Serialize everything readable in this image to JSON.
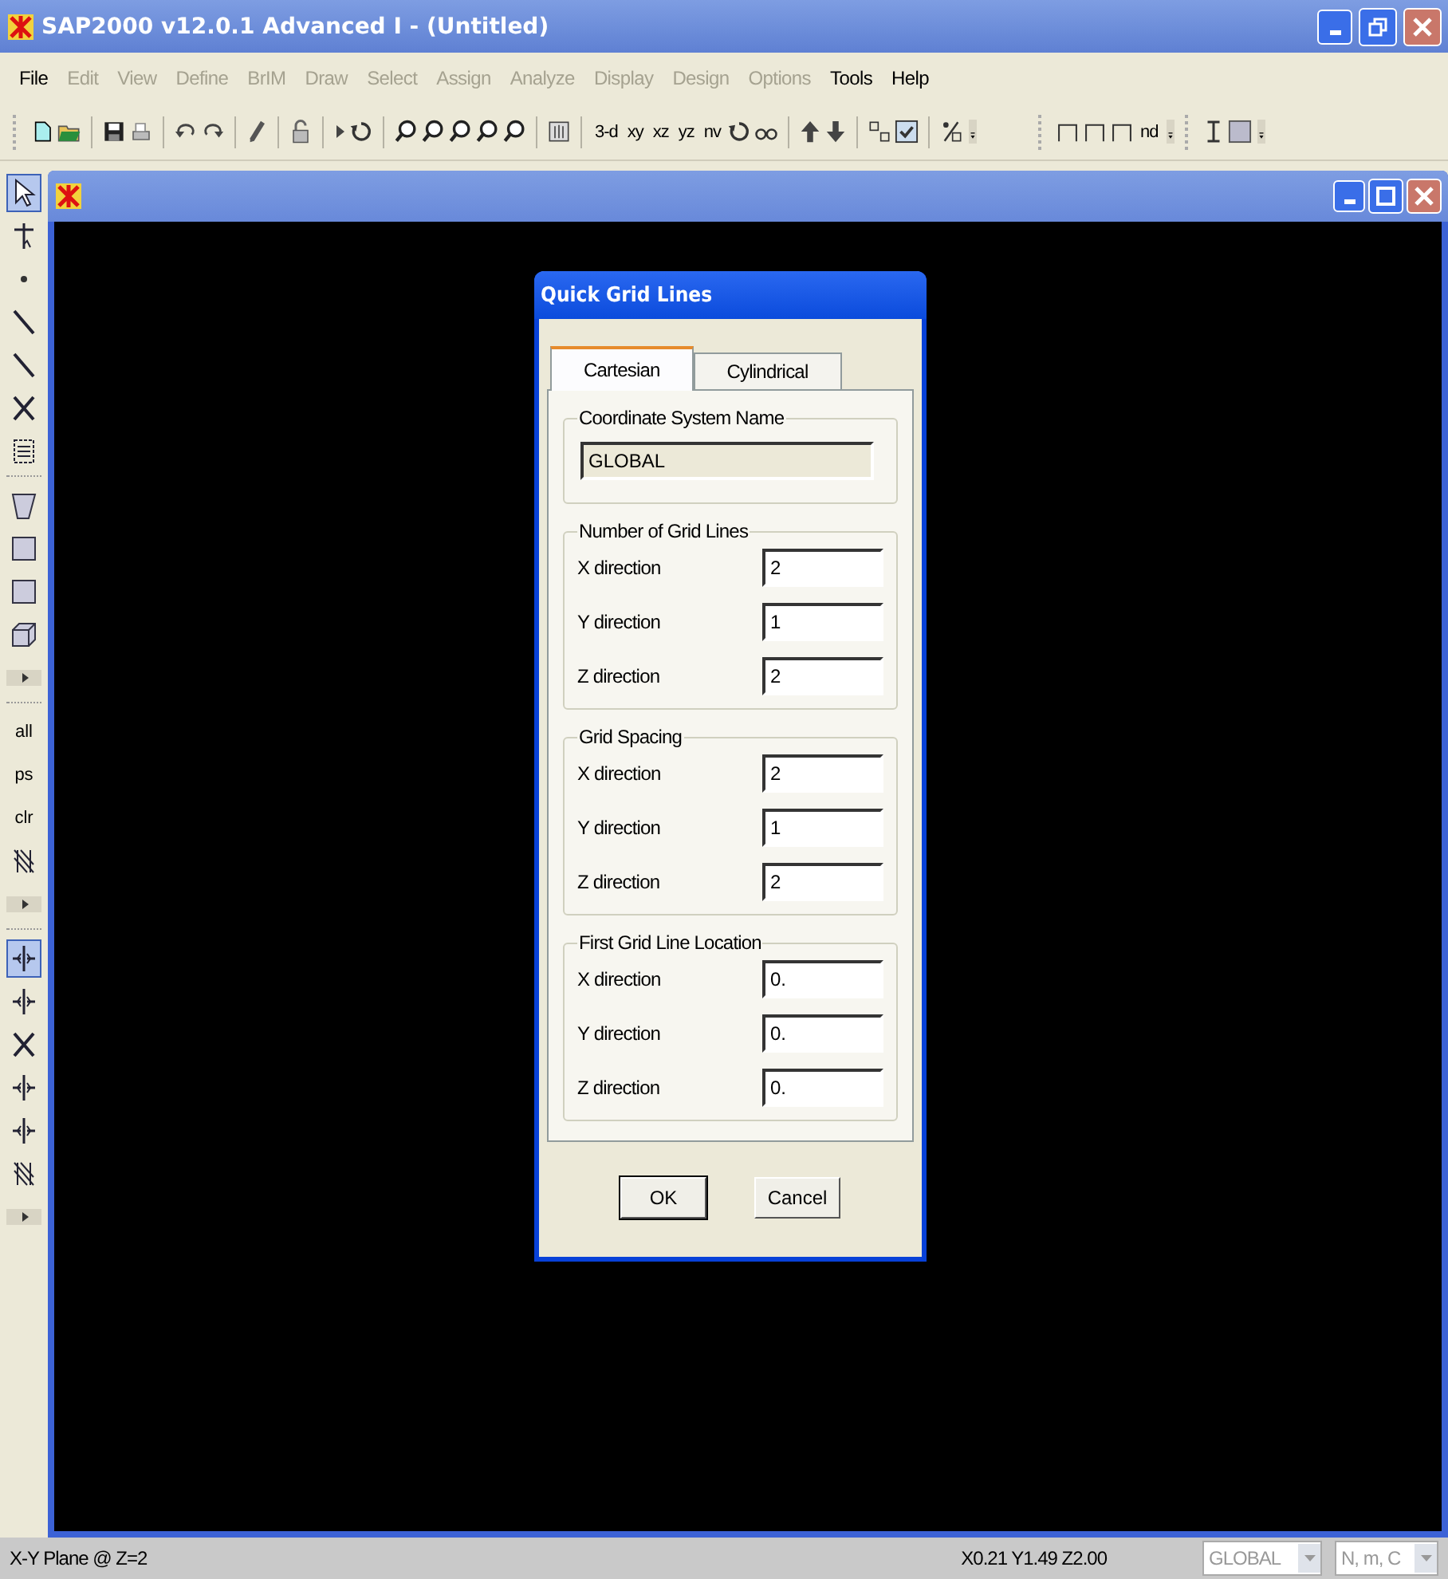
{
  "window": {
    "title": "SAP2000 v12.0.1 Advanced I  - (Untitled)"
  },
  "menu": [
    {
      "label": "File",
      "disabled": false
    },
    {
      "label": "Edit",
      "disabled": true
    },
    {
      "label": "View",
      "disabled": true
    },
    {
      "label": "Define",
      "disabled": true
    },
    {
      "label": "BrIM",
      "disabled": true
    },
    {
      "label": "Draw",
      "disabled": true
    },
    {
      "label": "Select",
      "disabled": true
    },
    {
      "label": "Assign",
      "disabled": true
    },
    {
      "label": "Analyze",
      "disabled": true
    },
    {
      "label": "Display",
      "disabled": true
    },
    {
      "label": "Design",
      "disabled": true
    },
    {
      "label": "Options",
      "disabled": true
    },
    {
      "label": "Tools",
      "disabled": false
    },
    {
      "label": "Help",
      "disabled": false
    }
  ],
  "toolbar": [
    {
      "kind": "grip"
    },
    {
      "kind": "new"
    },
    {
      "kind": "open"
    },
    {
      "kind": "sep"
    },
    {
      "kind": "save"
    },
    {
      "kind": "print"
    },
    {
      "kind": "sep"
    },
    {
      "kind": "undo"
    },
    {
      "kind": "redo"
    },
    {
      "kind": "sep"
    },
    {
      "kind": "pencil"
    },
    {
      "kind": "sep"
    },
    {
      "kind": "lock"
    },
    {
      "kind": "sep"
    },
    {
      "kind": "play"
    },
    {
      "kind": "rotate"
    },
    {
      "kind": "sep"
    },
    {
      "kind": "zoom"
    },
    {
      "kind": "zoom"
    },
    {
      "kind": "zoom"
    },
    {
      "kind": "zoom"
    },
    {
      "kind": "zoom"
    },
    {
      "kind": "sep"
    },
    {
      "kind": "pan"
    },
    {
      "kind": "sep"
    },
    {
      "kind": "text",
      "label": "3-d"
    },
    {
      "kind": "text",
      "label": "xy"
    },
    {
      "kind": "text",
      "label": "xz"
    },
    {
      "kind": "text",
      "label": "yz"
    },
    {
      "kind": "text",
      "label": "nv"
    },
    {
      "kind": "rotate"
    },
    {
      "kind": "glasses"
    },
    {
      "kind": "sep"
    },
    {
      "kind": "up"
    },
    {
      "kind": "down"
    },
    {
      "kind": "sep"
    },
    {
      "kind": "resize"
    },
    {
      "kind": "check"
    },
    {
      "kind": "sep"
    },
    {
      "kind": "percent"
    },
    {
      "kind": "end"
    },
    {
      "kind": "gap"
    },
    {
      "kind": "grip"
    },
    {
      "kind": "frame"
    },
    {
      "kind": "frame"
    },
    {
      "kind": "frame"
    },
    {
      "kind": "text",
      "label": "nd"
    },
    {
      "kind": "end"
    },
    {
      "kind": "grip"
    },
    {
      "kind": "ibeam"
    },
    {
      "kind": "square"
    },
    {
      "kind": "end"
    }
  ],
  "side_toolbar": [
    {
      "kind": "pointer",
      "selected": true
    },
    {
      "kind": "reshape",
      "selected": false
    },
    {
      "kind": "point",
      "selected": false
    },
    {
      "kind": "line",
      "selected": false
    },
    {
      "kind": "line",
      "selected": false
    },
    {
      "kind": "cross",
      "selected": false
    },
    {
      "kind": "list",
      "selected": false
    },
    {
      "kind": "sep"
    },
    {
      "kind": "poly",
      "selected": false
    },
    {
      "kind": "rect",
      "selected": false
    },
    {
      "kind": "rect",
      "selected": false
    },
    {
      "kind": "solid",
      "selected": false
    },
    {
      "kind": "more"
    },
    {
      "kind": "sep"
    },
    {
      "kind": "text",
      "label": "all",
      "selected": false
    },
    {
      "kind": "text",
      "label": "ps",
      "selected": false
    },
    {
      "kind": "text",
      "label": "clr",
      "selected": false
    },
    {
      "kind": "hatch",
      "selected": false
    },
    {
      "kind": "more"
    },
    {
      "kind": "sep"
    },
    {
      "kind": "snap",
      "selected": true
    },
    {
      "kind": "snap",
      "selected": false
    },
    {
      "kind": "cross",
      "selected": false
    },
    {
      "kind": "snap",
      "selected": false
    },
    {
      "kind": "snap",
      "selected": false
    },
    {
      "kind": "hatch",
      "selected": false
    },
    {
      "kind": "more"
    }
  ],
  "dialog": {
    "title": "Quick Grid Lines",
    "tabs": [
      {
        "label": "Cartesian",
        "selected": true
      },
      {
        "label": "Cylindrical",
        "selected": false
      }
    ],
    "coordinate_system": {
      "legend": "Coordinate System Name",
      "value": "GLOBAL"
    },
    "groups": [
      {
        "legend": "Number of Grid Lines",
        "fields": [
          {
            "label": "X direction",
            "value": "2"
          },
          {
            "label": "Y direction",
            "value": "1"
          },
          {
            "label": "Z direction",
            "value": "2"
          }
        ]
      },
      {
        "legend": "Grid Spacing",
        "fields": [
          {
            "label": "X direction",
            "value": "2"
          },
          {
            "label": "Y direction",
            "value": "1"
          },
          {
            "label": "Z direction",
            "value": "2"
          }
        ]
      },
      {
        "legend": "First Grid Line Location",
        "fields": [
          {
            "label": "X direction",
            "value": "0."
          },
          {
            "label": "Y direction",
            "value": "0."
          },
          {
            "label": "Z direction",
            "value": "0."
          }
        ]
      }
    ],
    "buttons": [
      {
        "label": "OK",
        "default": true
      },
      {
        "label": "Cancel",
        "default": false
      }
    ]
  },
  "status_bar": {
    "view": "X-Y Plane @ Z=2",
    "coordinates": "X0.21  Y1.49  Z2.00",
    "coordinate_system": "GLOBAL",
    "units": "N, m, C"
  }
}
